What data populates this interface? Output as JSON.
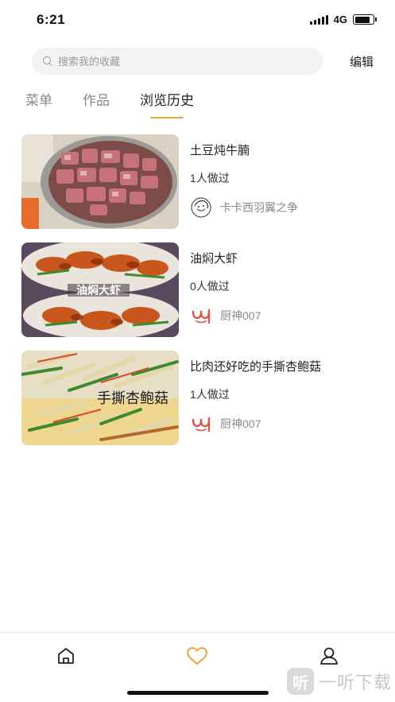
{
  "status_bar": {
    "time": "6:21",
    "network": "4G",
    "battery_level": 0.85
  },
  "search": {
    "placeholder": "搜索我的收藏",
    "edit_label": "编辑"
  },
  "tabs": [
    {
      "label": "菜单",
      "active": false
    },
    {
      "label": "作品",
      "active": false
    },
    {
      "label": "浏览历史",
      "active": true
    }
  ],
  "accent_color": "#f2a23a",
  "items": [
    {
      "title": "土豆炖牛腩",
      "cooked": "1人做过",
      "author": "卡卡西羽翼之争",
      "avatar": "sketch-avatar-icon"
    },
    {
      "title": "油焖大虾",
      "cooked": "0人做过",
      "author": "厨神007",
      "avatar": "chef-logo-icon",
      "image_text": "油焖大虾"
    },
    {
      "title": "比肉还好吃的手撕杏鲍菇",
      "cooked": "1人做过",
      "author": "厨神007",
      "avatar": "chef-logo-icon",
      "image_text": "手撕杏鲍菇"
    }
  ],
  "bottom_nav": [
    {
      "name": "home-icon",
      "active": false
    },
    {
      "name": "heart-icon",
      "active": true
    },
    {
      "name": "user-icon",
      "active": false
    }
  ],
  "watermark": {
    "logo_char": "听",
    "text": "一听下载"
  }
}
